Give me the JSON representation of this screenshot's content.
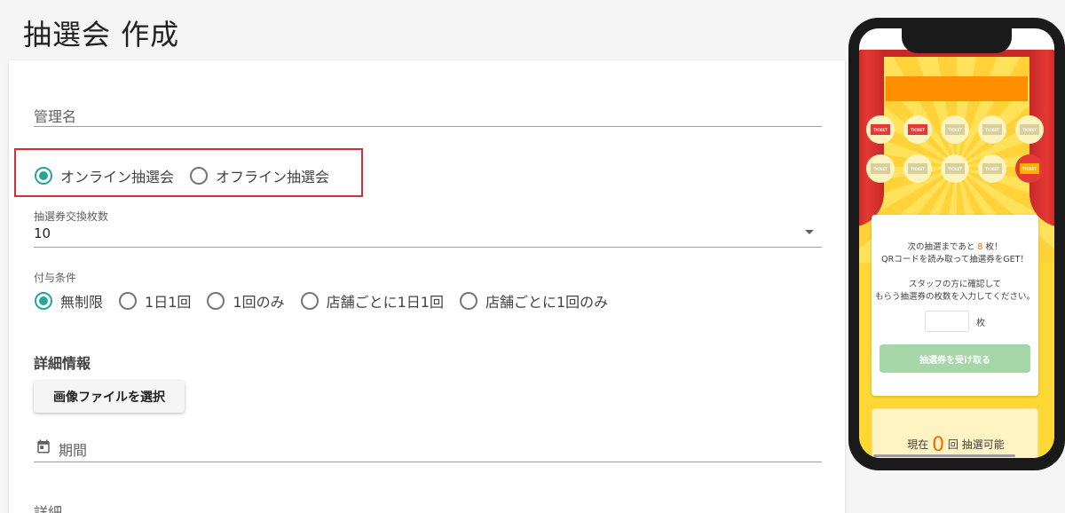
{
  "page": {
    "title": "抽選会 作成"
  },
  "form": {
    "admin_name_label": "管理名",
    "lottery_type": {
      "options": [
        "オンライン抽選会",
        "オフライン抽選会"
      ],
      "selected": 0
    },
    "ticket_exchange": {
      "label": "抽選券交換枚数",
      "value": "10"
    },
    "grant_condition": {
      "label": "付与条件",
      "options": [
        "無制限",
        "1日1回",
        "1回のみ",
        "店舗ごとに1日1回",
        "店舗ごとに1回のみ"
      ],
      "selected": 0
    },
    "details_section_title": "詳細情報",
    "file_button_label": "画像ファイルを選択",
    "period_label": "期間",
    "details_label": "詳細"
  },
  "preview": {
    "ticket_text": "TICKET",
    "next_draw_prefix": "次の抽選まであと",
    "next_draw_count": "8",
    "next_draw_suffix": "枚！",
    "qr_instruction": "QRコードを読み取って抽選券をGET！",
    "staff_line1": "スタッフの方に確認して",
    "staff_line2": "もらう抽選券の枚数を入力してください。",
    "unit": "枚",
    "receive_button": "抽選券を受け取る",
    "current_prefix": "現在",
    "current_count": "0",
    "current_suffix": "回 抽選可能"
  },
  "colors": {
    "accent": "#26a69a",
    "highlight": "#d32f2f",
    "phone_bg": "#fdd835"
  }
}
